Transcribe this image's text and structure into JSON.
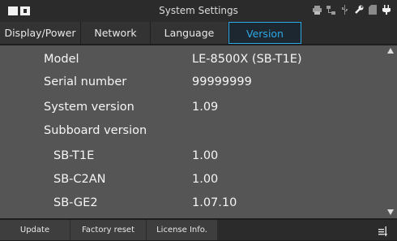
{
  "window": {
    "title": "System Settings"
  },
  "tabs": [
    {
      "label": "Display/Power",
      "active": false
    },
    {
      "label": "Network",
      "active": false
    },
    {
      "label": "Language",
      "active": false
    },
    {
      "label": "Version",
      "active": true
    }
  ],
  "version_info": {
    "rows": [
      {
        "key": "Model",
        "value": "LE-8500X (SB-T1E)"
      },
      {
        "key": "Serial number",
        "value": "99999999"
      },
      {
        "key": "System version",
        "value": "1.09"
      },
      {
        "key": "Subboard version",
        "value": ""
      },
      {
        "key": "SB-T1E",
        "value": "1.00"
      },
      {
        "key": "SB-C2AN",
        "value": "1.00"
      },
      {
        "key": "SB-GE2",
        "value": "1.07.10"
      }
    ]
  },
  "bottom_buttons": [
    {
      "label": "Update"
    },
    {
      "label": "Factory reset"
    },
    {
      "label": "License Info."
    }
  ],
  "status_icons": [
    "printer-icon",
    "network-icon",
    "usb-icon",
    "wrench-icon",
    "sd-card-icon",
    "power-plug-icon"
  ],
  "colors": {
    "accent": "#2ea8e6",
    "content_bg": "#555555",
    "bar_bg": "#2b2b2b"
  }
}
